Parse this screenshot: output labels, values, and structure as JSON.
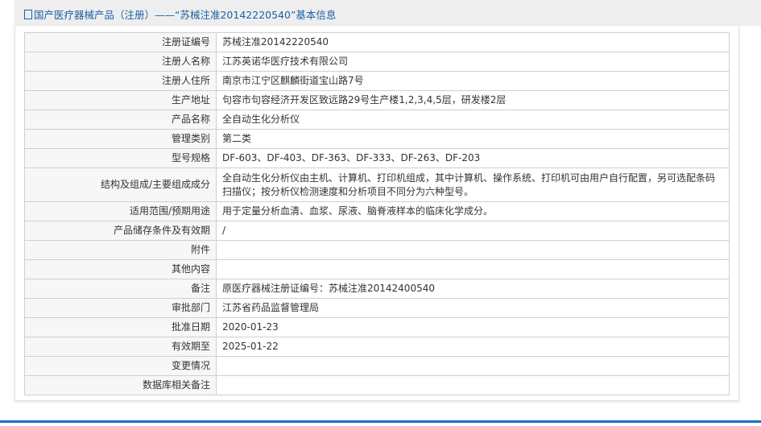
{
  "header": {
    "title": "国产医疗器械产品（注册）——“苏械注准20142220540”基本信息",
    "icon": "document-icon"
  },
  "rows": [
    {
      "label": "注册证编号",
      "value": "苏械注准20142220540"
    },
    {
      "label": "注册人名称",
      "value": "江苏英诺华医疗技术有限公司"
    },
    {
      "label": "注册人住所",
      "value": "南京市江宁区麒麟街道宝山路7号"
    },
    {
      "label": "生产地址",
      "value": "句容市句容经济开发区致远路29号生产楼1,2,3,4,5层，研发楼2层"
    },
    {
      "label": "产品名称",
      "value": "全自动生化分析仪"
    },
    {
      "label": "管理类别",
      "value": "第二类"
    },
    {
      "label": "型号规格",
      "value": "DF-603、DF-403、DF-363、DF-333、DF-263、DF-203"
    },
    {
      "label": "结构及组成/主要组成成分",
      "value": "全自动生化分析仪由主机、计算机、打印机组成，其中计算机、操作系统、打印机可由用户自行配置，另可选配条码扫描仪；按分析仪检测速度和分析项目不同分为六种型号。"
    },
    {
      "label": "适用范围/预期用途",
      "value": "用于定量分析血清、血浆、尿液、脑脊液样本的临床化学成分。"
    },
    {
      "label": "产品储存条件及有效期",
      "value": "/"
    },
    {
      "label": "附件",
      "value": ""
    },
    {
      "label": "其他内容",
      "value": ""
    },
    {
      "label": "备注",
      "value": "原医疗器械注册证编号：苏械注准20142400540"
    },
    {
      "label": "审批部门",
      "value": "江苏省药品监督管理局"
    },
    {
      "label": "批准日期",
      "value": "2020-01-23"
    },
    {
      "label": "有效期至",
      "value": "2025-01-22"
    },
    {
      "label": "变更情况",
      "value": ""
    },
    {
      "label": "数据库相关备注",
      "value": ""
    }
  ]
}
